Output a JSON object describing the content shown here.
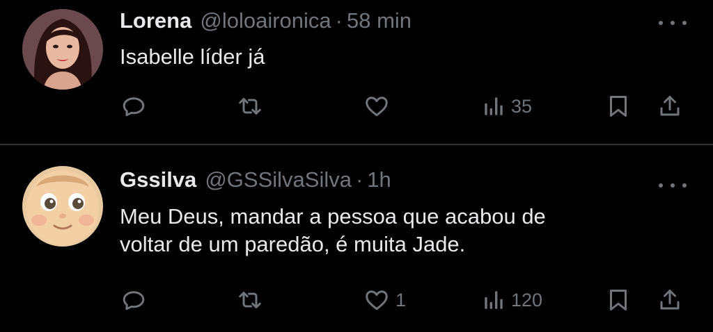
{
  "tweets": [
    {
      "display_name": "Lorena",
      "handle": "@loloaironica",
      "separator": "·",
      "time": "58 min",
      "text_lines": [
        "Isabelle líder já"
      ],
      "actions": {
        "reply_count": "",
        "repost_count": "",
        "like_count": "",
        "views_count": "35"
      }
    },
    {
      "display_name": "Gssilva",
      "handle": "@GSSilvaSilva",
      "separator": "·",
      "time": "1h",
      "text_lines": [
        "Meu Deus, mandar a pessoa que acabou de",
        "voltar de um paredão, é muita Jade."
      ],
      "actions": {
        "reply_count": "",
        "repost_count": "",
        "like_count": "1",
        "views_count": "120"
      }
    }
  ],
  "icons": {
    "reply": "reply-icon",
    "repost": "repost-icon",
    "like": "heart-icon",
    "views": "views-icon",
    "bookmark": "bookmark-icon",
    "share": "share-icon",
    "more": "more-icon"
  },
  "colors": {
    "background": "#000000",
    "text_primary": "#e7e9ea",
    "text_secondary": "#71767b",
    "divider": "#2f3336"
  }
}
